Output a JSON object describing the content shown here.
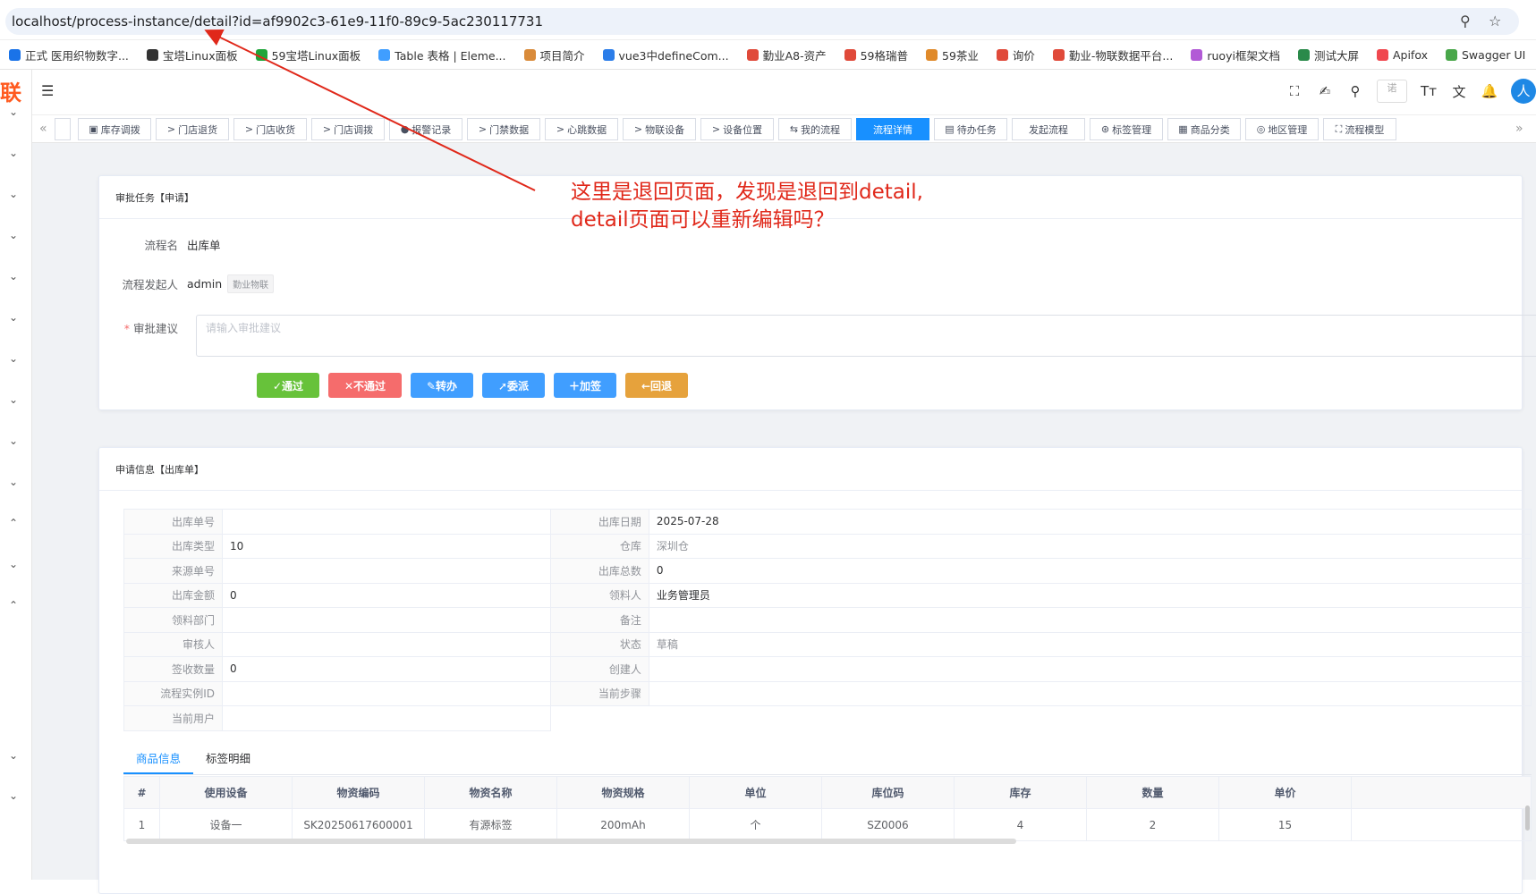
{
  "browser": {
    "url": "localhost/process-instance/detail?id=af9902c3-61e9-11f0-89c9-5ac230117731",
    "bookmarks": [
      {
        "label": "正式 医用织物数字...",
        "color": "#1a73e8"
      },
      {
        "label": "宝塔Linux面板",
        "color": "#333333"
      },
      {
        "label": "59宝塔Linux面板",
        "color": "#20a53a"
      },
      {
        "label": "Table 表格 | Eleme...",
        "color": "#409eff"
      },
      {
        "label": "项目简介",
        "color": "#d98b3a"
      },
      {
        "label": "vue3中defineCom...",
        "color": "#2b7de9"
      },
      {
        "label": "勤业A8-资产",
        "color": "#e04a3a"
      },
      {
        "label": "59格瑞普",
        "color": "#e04a3a"
      },
      {
        "label": "59茶业",
        "color": "#e08a2a"
      },
      {
        "label": "询价",
        "color": "#e04a3a"
      },
      {
        "label": "勤业-物联数据平台...",
        "color": "#e04a3a"
      },
      {
        "label": "ruoyi框架文档",
        "color": "#b25ad6"
      },
      {
        "label": "测试大屏",
        "color": "#2a8a4a"
      },
      {
        "label": "Apifox",
        "color": "#f0484f"
      },
      {
        "label": "Swagger UI",
        "color": "#49a74a"
      }
    ]
  },
  "app": {
    "logo": "联",
    "search_placeholder": "诺",
    "avatar": "人",
    "tags": [
      {
        "label": "库存调拨",
        "icon": "▣"
      },
      {
        "label": "门店退货",
        "icon": ">"
      },
      {
        "label": "门店收货",
        "icon": ">"
      },
      {
        "label": "门店调拨",
        "icon": ">"
      },
      {
        "label": "报警记录",
        "icon": "●"
      },
      {
        "label": "门禁数据",
        "icon": ">"
      },
      {
        "label": "心跳数据",
        "icon": ">"
      },
      {
        "label": "物联设备",
        "icon": ">"
      },
      {
        "label": "设备位置",
        "icon": ">"
      },
      {
        "label": "我的流程",
        "icon": "⇆"
      },
      {
        "label": "流程详情",
        "icon": ""
      },
      {
        "label": "待办任务",
        "icon": "▤"
      },
      {
        "label": "发起流程",
        "icon": ""
      },
      {
        "label": "标签管理",
        "icon": "⊛"
      },
      {
        "label": "商品分类",
        "icon": "▦"
      },
      {
        "label": "地区管理",
        "icon": "◎"
      },
      {
        "label": "流程模型",
        "icon": "⛶"
      }
    ],
    "active_tag": "流程详情"
  },
  "approval": {
    "title": "审批任务【申请】",
    "flow_name_label": "流程名",
    "flow_name": "出库单",
    "initiator_label": "流程发起人",
    "initiator": "admin",
    "initiator_dept": "勤业物联",
    "suggestion_label": "审批建议",
    "suggestion_placeholder": "请输入审批建议",
    "buttons": {
      "approve": "✓通过",
      "reject": "✕不通过",
      "transfer": "✎转办",
      "delegate": "➚委派",
      "add_sign": "＋加签",
      "return": "←回退"
    },
    "colors": {
      "approve": "#67c23a",
      "reject": "#f56c6c",
      "transfer": "#409eff",
      "delegate": "#409eff",
      "add_sign": "#409eff",
      "return": "#e6a23c"
    }
  },
  "info": {
    "title": "申请信息【出库单】",
    "rows": [
      [
        {
          "label": "出库单号",
          "value": ""
        },
        {
          "label": "出库日期",
          "value": "2025-07-28"
        }
      ],
      [
        {
          "label": "出库类型",
          "value": "10"
        },
        {
          "label": "仓库",
          "value": "深圳仓"
        }
      ],
      [
        {
          "label": "来源单号",
          "value": ""
        },
        {
          "label": "出库总数",
          "value": "0"
        }
      ],
      [
        {
          "label": "出库金额",
          "value": "0"
        },
        {
          "label": "领料人",
          "value": "业务管理员"
        }
      ],
      [
        {
          "label": "领料部门",
          "value": ""
        },
        {
          "label": "备注",
          "value": ""
        }
      ],
      [
        {
          "label": "审核人",
          "value": ""
        },
        {
          "label": "状态",
          "value": "草稿"
        }
      ],
      [
        {
          "label": "签收数量",
          "value": "0"
        },
        {
          "label": "创建人",
          "value": ""
        }
      ],
      [
        {
          "label": "流程实例ID",
          "value": ""
        },
        {
          "label": "当前步骤",
          "value": ""
        }
      ],
      [
        {
          "label": "当前用户",
          "value": ""
        }
      ]
    ],
    "tabs": [
      "商品信息",
      "标签明细"
    ],
    "table_headers": [
      "#",
      "使用设备",
      "物资编码",
      "物资名称",
      "物资规格",
      "单位",
      "库位码",
      "库存",
      "数量",
      "单价"
    ],
    "table_rows": [
      [
        "1",
        "设备一",
        "SK20250617600001",
        "有源标签",
        "200mAh",
        "个",
        "SZ0006",
        "4",
        "2",
        "15"
      ]
    ]
  },
  "annotation": {
    "line1": "这里是退回页面，发现是退回到detail,",
    "line2": "detail页面可以重新编辑吗？"
  }
}
